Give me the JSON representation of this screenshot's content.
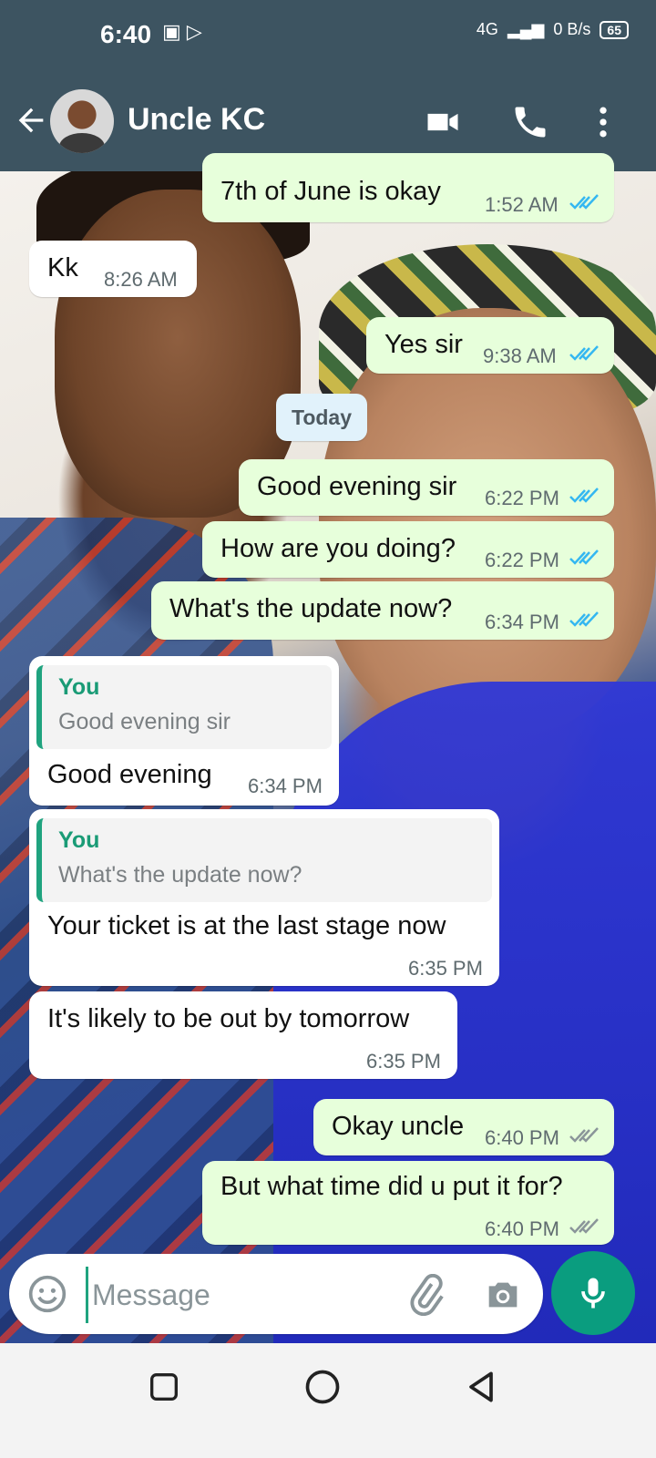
{
  "status_bar": {
    "time": "6:40",
    "network": "4G",
    "data_speed": "0 B/s",
    "battery": "65"
  },
  "header": {
    "contact_name": "Uncle KC"
  },
  "messages": [
    {
      "direction": "outgoing",
      "text": "7th of June is okay",
      "time": "1:52 AM",
      "status": "read"
    },
    {
      "direction": "incoming",
      "text": "Kk",
      "time": "8:26 AM"
    },
    {
      "direction": "outgoing",
      "text": "Yes sir",
      "time": "9:38 AM",
      "status": "read"
    },
    {
      "direction": "outgoing",
      "text": "Good evening sir",
      "time": "6:22 PM",
      "status": "read"
    },
    {
      "direction": "outgoing",
      "text": "How are you doing?",
      "time": "6:22 PM",
      "status": "read"
    },
    {
      "direction": "outgoing",
      "text": "What's the update now?",
      "time": "6:34 PM",
      "status": "read"
    },
    {
      "direction": "incoming",
      "reply_author": "You",
      "reply_text": "Good evening sir",
      "text": "Good evening",
      "time": "6:34 PM"
    },
    {
      "direction": "incoming",
      "reply_author": "You",
      "reply_text": "What's the update now?",
      "text": "Your ticket is at the last stage now",
      "time": "6:35 PM"
    },
    {
      "direction": "incoming",
      "text": "It's likely to be out by tomorrow",
      "time": "6:35 PM"
    },
    {
      "direction": "outgoing",
      "text": "Okay uncle",
      "time": "6:40 PM",
      "status": "delivered"
    },
    {
      "direction": "outgoing",
      "text": "But what time did u put it for?",
      "time": "6:40 PM",
      "status": "delivered"
    }
  ],
  "date_separator": "Today",
  "composer": {
    "placeholder": "Message"
  },
  "colors": {
    "header_bg": "#3d5461",
    "outgoing_bubble": "#e7ffdb",
    "incoming_bubble": "#ffffff",
    "read_ticks": "#34b7f1",
    "delivered_ticks": "#8a9599",
    "accent": "#0a9d7f"
  },
  "icons": {
    "back": "back-arrow-icon",
    "video": "video-call-icon",
    "call": "phone-call-icon",
    "menu": "more-vert-icon",
    "emoji": "emoji-icon",
    "attach": "paperclip-icon",
    "camera": "camera-icon",
    "mic": "mic-icon"
  }
}
